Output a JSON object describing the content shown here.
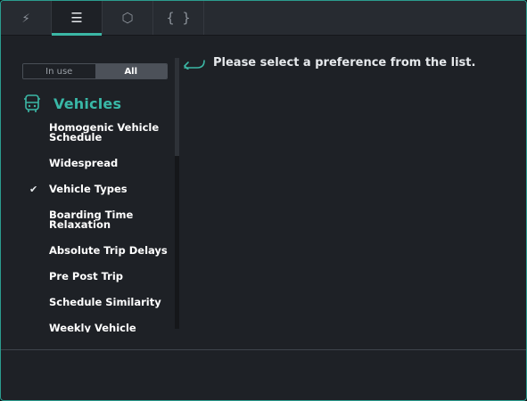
{
  "tabs": [
    {
      "icon": "lightning-icon",
      "glyph": "⚡",
      "active": false
    },
    {
      "icon": "list-icon",
      "glyph": "☰",
      "active": true
    },
    {
      "icon": "map-icon",
      "glyph": "⬡",
      "active": false
    },
    {
      "icon": "braces-icon",
      "glyph": "{ }",
      "active": false
    }
  ],
  "filter": {
    "in_use_label": "In use",
    "all_label": "All",
    "selected": "All"
  },
  "group": {
    "icon": "bus-icon",
    "title": "Vehicles"
  },
  "items": [
    {
      "label": "Homogenic Vehicle Schedule",
      "checked": false
    },
    {
      "label": "Widespread",
      "checked": false
    },
    {
      "label": "Vehicle Types",
      "checked": true
    },
    {
      "label": "Boarding Time Relaxation",
      "checked": false
    },
    {
      "label": "Absolute Trip Delays",
      "checked": false
    },
    {
      "label": "Pre Post Trip",
      "checked": false
    },
    {
      "label": "Schedule Similarity",
      "checked": false
    },
    {
      "label": "Weekly Vehicle",
      "checked": false
    }
  ],
  "check_glyph": "✔",
  "hint": {
    "icon": "arrow-left-icon",
    "text": "Please select a preference from the list."
  },
  "colors": {
    "accent": "#3bb7a5",
    "background": "#1e2126",
    "tabbar": "#272b31",
    "border": "#2b9c8f"
  }
}
